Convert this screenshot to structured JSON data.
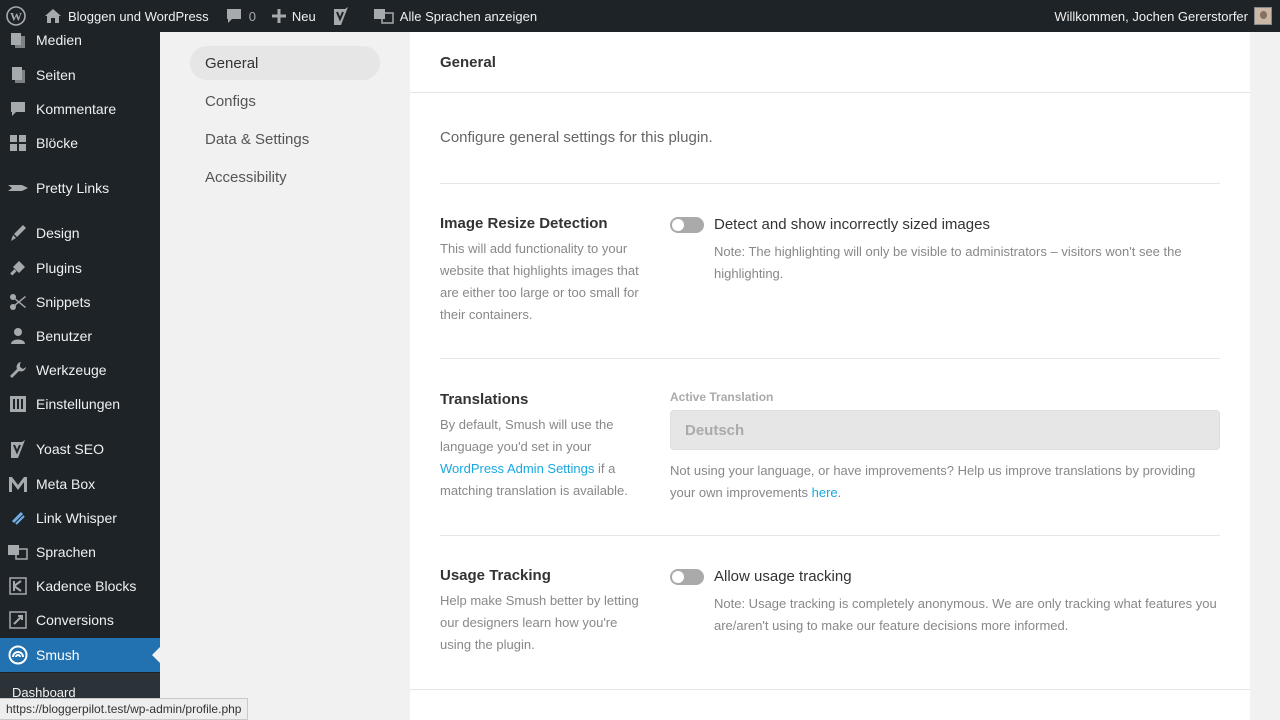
{
  "adminbar": {
    "site_name": "Bloggen und WordPress",
    "comments_count": "0",
    "new_label": "Neu",
    "languages_label": "Alle Sprachen anzeigen",
    "welcome": "Willkommen, Jochen Gererstorfer"
  },
  "sidebar": {
    "items": [
      {
        "label": "Medien",
        "icon": "media-icon"
      },
      {
        "label": "Seiten",
        "icon": "pages-icon"
      },
      {
        "label": "Kommentare",
        "icon": "comments-icon"
      },
      {
        "label": "Blöcke",
        "icon": "blocks-icon"
      },
      {
        "label": "Pretty Links",
        "icon": "pretty-links-icon"
      },
      {
        "label": "Design",
        "icon": "design-icon"
      },
      {
        "label": "Plugins",
        "icon": "plugins-icon"
      },
      {
        "label": "Snippets",
        "icon": "snippets-icon"
      },
      {
        "label": "Benutzer",
        "icon": "users-icon"
      },
      {
        "label": "Werkzeuge",
        "icon": "tools-icon"
      },
      {
        "label": "Einstellungen",
        "icon": "settings-icon"
      },
      {
        "label": "Yoast SEO",
        "icon": "yoast-icon"
      },
      {
        "label": "Meta Box",
        "icon": "meta-box-icon"
      },
      {
        "label": "Link Whisper",
        "icon": "link-whisper-icon"
      },
      {
        "label": "Sprachen",
        "icon": "languages-icon"
      },
      {
        "label": "Kadence Blocks",
        "icon": "kadence-icon"
      },
      {
        "label": "Conversions",
        "icon": "conversions-icon"
      },
      {
        "label": "Smush",
        "icon": "smush-icon"
      }
    ],
    "submenu_dashboard": "Dashboard"
  },
  "plugin_nav": {
    "items": [
      "General",
      "Configs",
      "Data & Settings",
      "Accessibility"
    ],
    "current": "General"
  },
  "main": {
    "title": "General",
    "description": "Configure general settings for this plugin.",
    "image_resize": {
      "label": "Image Resize Detection",
      "description": "This will add functionality to your website that highlights images that are either too large or too small for their containers.",
      "toggle_label": "Detect and show incorrectly sized images",
      "toggle_on": false,
      "note": "Note: The highlighting will only be visible to administrators – visitors won't see the highlighting."
    },
    "translations": {
      "label": "Translations",
      "description_pre": "By default, Smush will use the language you'd set in your ",
      "description_link": "WordPress Admin Settings",
      "description_post": " if a matching translation is available.",
      "field_label": "Active Translation",
      "value": "Deutsch",
      "help_pre": "Not using your language, or have improvements? Help us improve translations by providing your own improvements ",
      "help_link": "here",
      "help_post": "."
    },
    "usage_tracking": {
      "label": "Usage Tracking",
      "description": "Help make Smush better by letting our designers learn how you're using the plugin.",
      "toggle_label": "Allow usage tracking",
      "toggle_on": false,
      "note": "Note: Usage tracking is completely anonymous. We are only tracking what features you are/aren't using to make our feature decisions more informed."
    }
  },
  "statusbar": {
    "url": "https://bloggerpilot.test/wp-admin/profile.php"
  },
  "colors": {
    "admin_dark": "#1d2327",
    "active_blue": "#2271b1",
    "link_blue": "#17a8e3"
  }
}
